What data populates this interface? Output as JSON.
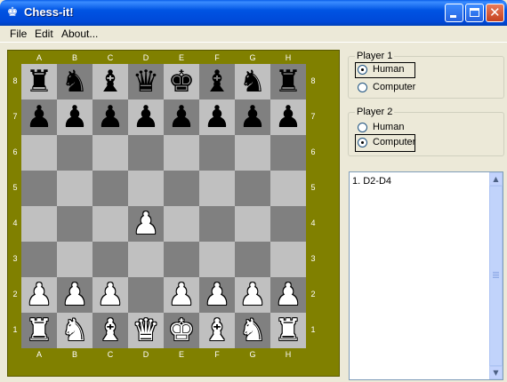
{
  "window": {
    "title": "Chess-it!",
    "icon": "king-icon"
  },
  "menu": {
    "file": "File",
    "edit": "Edit",
    "about": "About..."
  },
  "board": {
    "files": [
      "A",
      "B",
      "C",
      "D",
      "E",
      "F",
      "G",
      "H"
    ],
    "ranks": [
      "8",
      "7",
      "6",
      "5",
      "4",
      "3",
      "2",
      "1"
    ],
    "rows": [
      [
        "bR",
        "bN",
        "bB",
        "bQ",
        "bK",
        "bB",
        "bN",
        "bR"
      ],
      [
        "bP",
        "bP",
        "bP",
        "bP",
        "bP",
        "bP",
        "bP",
        "bP"
      ],
      [
        "",
        "",
        "",
        "",
        "",
        "",
        "",
        ""
      ],
      [
        "",
        "",
        "",
        "",
        "",
        "",
        "",
        ""
      ],
      [
        "",
        "",
        "",
        "wP",
        "",
        "",
        "",
        ""
      ],
      [
        "",
        "",
        "",
        "",
        "",
        "",
        "",
        ""
      ],
      [
        "wP",
        "wP",
        "wP",
        "",
        "wP",
        "wP",
        "wP",
        "wP"
      ],
      [
        "wR",
        "wN",
        "wB",
        "wQ",
        "wK",
        "wB",
        "wN",
        "wR"
      ]
    ],
    "colors": {
      "frame": "#808000",
      "light": "#c0c0c0",
      "dark": "#808080"
    }
  },
  "player1": {
    "title": "Player 1",
    "human": "Human",
    "computer": "Computer",
    "selected": "human"
  },
  "player2": {
    "title": "Player 2",
    "human": "Human",
    "computer": "Computer",
    "selected": "computer"
  },
  "moves": [
    "1. D2-D4"
  ]
}
